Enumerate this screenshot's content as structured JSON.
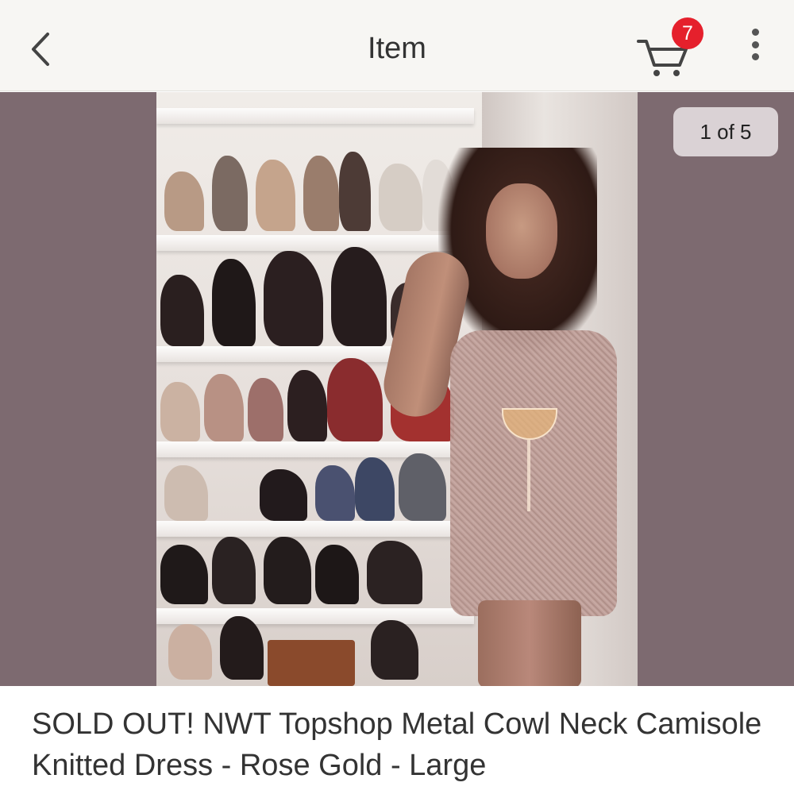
{
  "nav": {
    "title": "Item",
    "cart_count": "7",
    "icons": {
      "back": "chevron-left-icon",
      "cart": "shopping-cart-icon",
      "more": "more-vertical-icon"
    }
  },
  "carousel": {
    "counter": "1 of 5",
    "background_color": "#7d6a70"
  },
  "item": {
    "title": "SOLD OUT! NWT Topshop Metal Cowl Neck Camisole Knitted Dress - Rose Gold - Large"
  },
  "colors": {
    "badge": "#e5202c",
    "nav_background": "#f7f6f3"
  }
}
